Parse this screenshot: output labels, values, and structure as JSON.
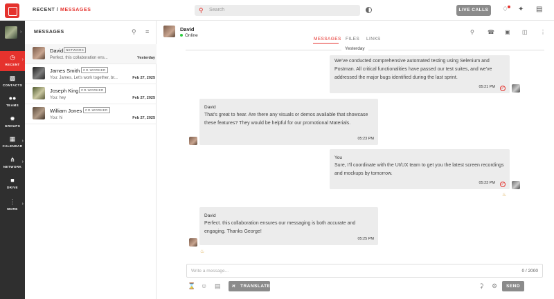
{
  "topbar": {
    "breadcrumb_root": "RECENT",
    "breadcrumb_sep": " / ",
    "breadcrumb_current": "MESSAGES",
    "search_placeholder": "Search",
    "live_calls_label": "LIVE CALLS"
  },
  "rail": {
    "items": [
      {
        "label": "RECENT",
        "icon": "clock-icon"
      },
      {
        "label": "CONTACTS",
        "icon": "contact-card-icon"
      },
      {
        "label": "TEAMS",
        "icon": "team-icon"
      },
      {
        "label": "GROUPS",
        "icon": "groups-icon"
      },
      {
        "label": "CALENDAR",
        "icon": "calendar-icon"
      },
      {
        "label": "NETWORK",
        "icon": "network-icon"
      },
      {
        "label": "DRIVE",
        "icon": "drive-icon"
      },
      {
        "label": "MORE",
        "icon": "more-icon"
      }
    ]
  },
  "conversations": {
    "title": "MESSAGES",
    "items": [
      {
        "name": "David",
        "tag": "NETWORK",
        "preview": "Perfect. this collaboration ens...",
        "date": "Yesterday"
      },
      {
        "name": "James Smith",
        "tag": "CO-WORKER",
        "preview": "You:  James, Let's work together, br...",
        "date": "Feb 27, 2025"
      },
      {
        "name": "Joseph King",
        "tag": "CO-WORKER",
        "preview": "You:  hey",
        "date": "Feb 27, 2025"
      },
      {
        "name": "William Jones",
        "tag": "CO-WORKER",
        "preview": "You:  hi",
        "date": "Feb 27, 2025"
      }
    ]
  },
  "chat": {
    "contact_name": "David",
    "status": "Online",
    "tabs": [
      "MESSAGES",
      "FILES",
      "LINKS"
    ],
    "day_divider": "Yesterday",
    "messages": [
      {
        "sender": "",
        "text": "We've conducted comprehensive automated testing using Selenium and Postman. All critical functionalities have passed our test suites, and we've addressed the major bugs identified during the last sprint.",
        "time": "05:21 PM",
        "mine": true
      },
      {
        "sender": "David",
        "text": "That's great to hear. Are there any visuals or demos available that showcase these features? They would be helpful for our promotional Materials.",
        "time": "05:23 PM",
        "mine": false
      },
      {
        "sender": "You",
        "text": "Sure, I'll coordinate with the UI/UX team to get you the latest screen recordings and mockups by tomorrow.",
        "time": "05:23 PM",
        "mine": true
      },
      {
        "sender": "David",
        "text": "Perfect. this collaboration ensures our messaging is both accurate and engaging. Thanks George!",
        "time": "05:25 PM",
        "mine": false
      }
    ],
    "composer_placeholder": "Write a message...",
    "char_count": "0 / 2000",
    "translate_label": "TRANSLATE",
    "send_label": "SEND"
  }
}
